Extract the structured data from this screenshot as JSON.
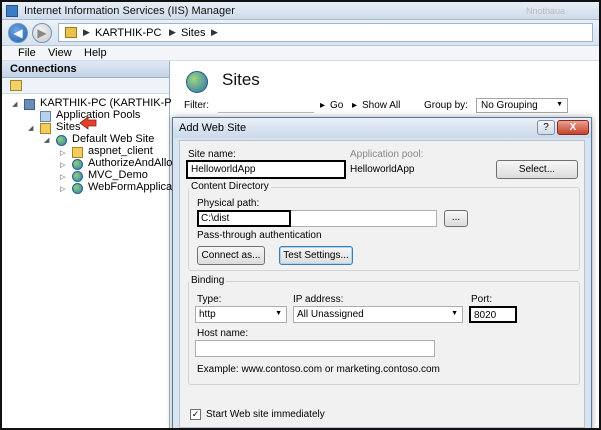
{
  "window": {
    "title": "Internet Information Services (IIS) Manager",
    "ghost_text": "Nnothaua"
  },
  "address": {
    "crumbs": [
      "KARTHIK-PC",
      "Sites"
    ]
  },
  "menu": [
    "File",
    "View",
    "Help"
  ],
  "connections": {
    "header": "Connections",
    "tree": {
      "server": "KARTHIK-PC (KARTHIK-PC\\s",
      "app_pools": "Application Pools",
      "sites": "Sites",
      "default_site": "Default Web Site",
      "children": [
        "aspnet_client",
        "AuthorizeAndAllov",
        "MVC_Demo",
        "WebFormApplicati"
      ]
    }
  },
  "page": {
    "title": "Sites",
    "filter_label": "Filter:",
    "go_label": "Go",
    "show_all_label": "Show All",
    "group_by_label": "Group by:",
    "group_by_value": "No Grouping"
  },
  "dialog": {
    "title": "Add Web Site",
    "help_label": "?",
    "close_label": "X",
    "site_name_label": "Site name:",
    "site_name_value": "HelloworldApp",
    "app_pool_label": "Application pool:",
    "app_pool_value": "HelloworldApp",
    "select_button": "Select...",
    "content_directory_legend": "Content Directory",
    "physical_path_label": "Physical path:",
    "physical_path_value": "C:\\dist",
    "browse_button": "...",
    "pass_through_text": "Pass-through authentication",
    "connect_as_button": "Connect as...",
    "test_settings_button": "Test Settings...",
    "binding_legend": "Binding",
    "type_label": "Type:",
    "type_value": "http",
    "ip_label": "IP address:",
    "ip_value": "All Unassigned",
    "port_label": "Port:",
    "port_value": "8020",
    "host_name_label": "Host name:",
    "host_name_value": "",
    "example_text": "Example: www.contoso.com or marketing.contoso.com",
    "start_immediately_label": "Start Web site immediately",
    "start_immediately_checked": "✓"
  }
}
